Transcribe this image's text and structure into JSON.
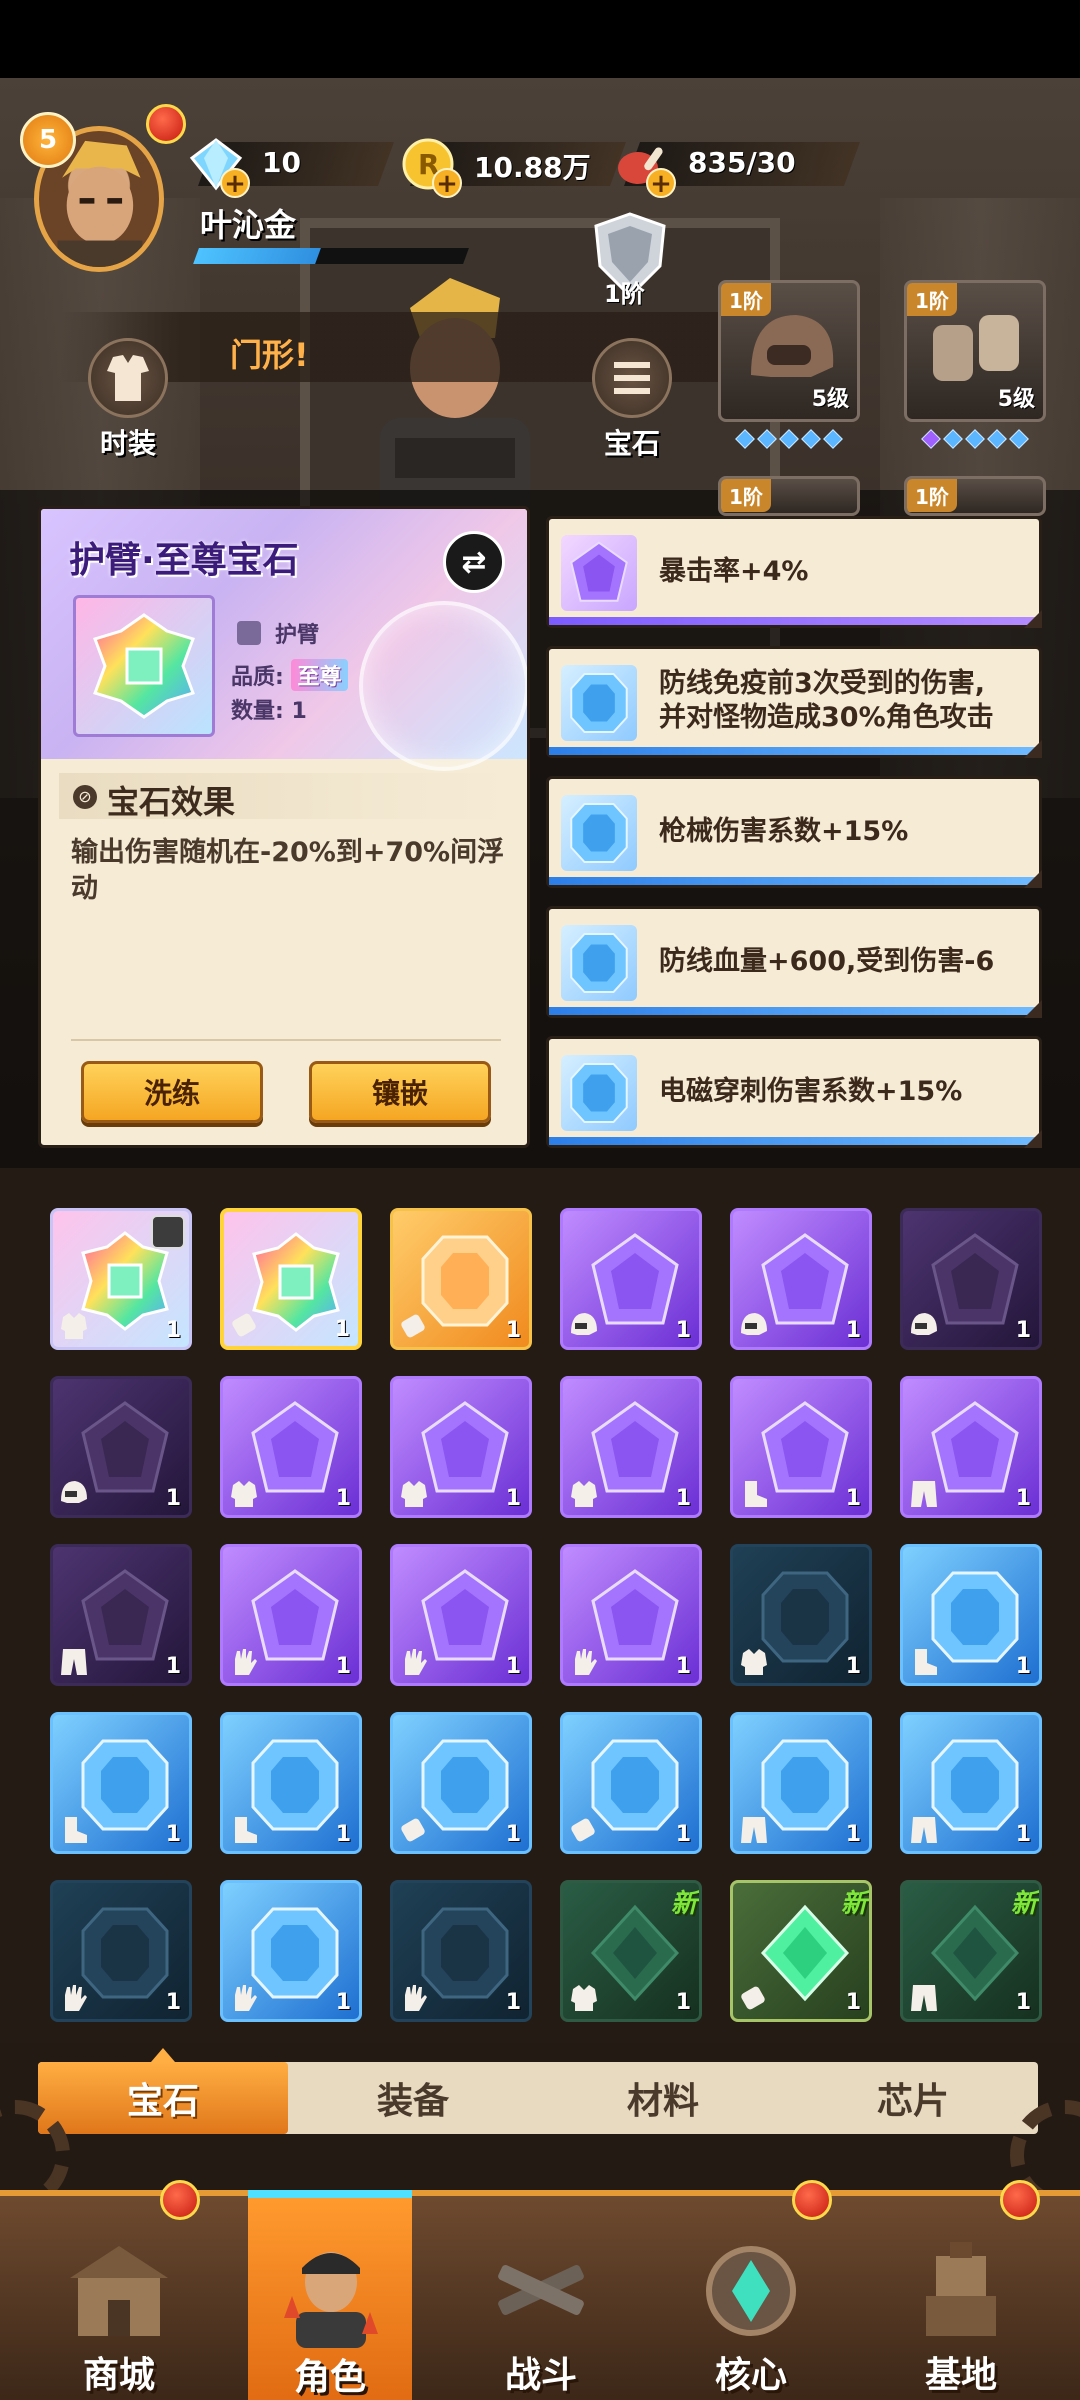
{
  "player": {
    "level": "5",
    "name": "叶沁金",
    "xp_fraction": 0.45
  },
  "resources": {
    "gems": "10",
    "coins": "10.88万",
    "stamina": "835/30"
  },
  "tier_label": "1阶",
  "marquee_text": "门形!",
  "side_buttons": {
    "fashion": "时装",
    "gem": "宝石"
  },
  "equipment": [
    {
      "tier": "1阶",
      "level": "5级",
      "icon": "helmet-icon"
    },
    {
      "tier": "1阶",
      "level": "5级",
      "icon": "gauntlet-icon"
    },
    {
      "tier": "1阶",
      "level": "",
      "icon": "slot-icon"
    },
    {
      "tier": "1阶",
      "level": "",
      "icon": "slot-icon"
    }
  ],
  "detail": {
    "title": "护臂·至尊宝石",
    "swap_glyph": "⇄",
    "slot": "护臂",
    "quality_label": "品质:",
    "quality_value": "至尊",
    "quantity_label": "数量:",
    "quantity_value": "1",
    "effect_title": "宝石效果",
    "effect_text": "输出伤害随机在-20%到+70%间浮动",
    "reforge_button": "洗练",
    "inlay_button": "镶嵌"
  },
  "affixes": [
    {
      "color": "purple",
      "line1": "暴击率+4%",
      "line2": ""
    },
    {
      "color": "blue",
      "line1": "防线免疫前3次受到的伤害,",
      "line2": "并对怪物造成30%角色攻击"
    },
    {
      "color": "blue",
      "line1": "枪械伤害系数+15%",
      "line2": ""
    },
    {
      "color": "blue",
      "line1": "防线血量+600,受到伤害-6",
      "line2": ""
    },
    {
      "color": "blue",
      "line1": "电磁穿刺伤害系数+15%",
      "line2": ""
    }
  ],
  "grid": [
    {
      "style": "prism",
      "slot": "armor",
      "count": "1",
      "lock": true
    },
    {
      "style": "prism",
      "slot": "arm",
      "count": "1",
      "selected": true
    },
    {
      "style": "orange",
      "slot": "arm",
      "count": "1"
    },
    {
      "style": "purple",
      "slot": "helmet",
      "count": "1"
    },
    {
      "style": "purple",
      "slot": "helmet",
      "count": "1"
    },
    {
      "style": "purple-dim",
      "slot": "helmet",
      "count": "1"
    },
    {
      "style": "purple-dim",
      "slot": "helmet",
      "count": "1"
    },
    {
      "style": "purple",
      "slot": "armor",
      "count": "1"
    },
    {
      "style": "purple",
      "slot": "armor",
      "count": "1"
    },
    {
      "style": "purple",
      "slot": "armor",
      "count": "1"
    },
    {
      "style": "purple",
      "slot": "boot",
      "count": "1"
    },
    {
      "style": "purple",
      "slot": "pants",
      "count": "1"
    },
    {
      "style": "purple-dim",
      "slot": "pants",
      "count": "1"
    },
    {
      "style": "purple",
      "slot": "glove",
      "count": "1"
    },
    {
      "style": "purple",
      "slot": "glove",
      "count": "1"
    },
    {
      "style": "purple",
      "slot": "glove",
      "count": "1"
    },
    {
      "style": "blue-dim",
      "slot": "armor",
      "count": "1"
    },
    {
      "style": "blue",
      "slot": "boot",
      "count": "1"
    },
    {
      "style": "blue",
      "slot": "boot",
      "count": "1"
    },
    {
      "style": "blue",
      "slot": "boot",
      "count": "1"
    },
    {
      "style": "blue",
      "slot": "arm",
      "count": "1"
    },
    {
      "style": "blue",
      "slot": "arm",
      "count": "1"
    },
    {
      "style": "blue",
      "slot": "pants",
      "count": "1"
    },
    {
      "style": "blue",
      "slot": "pants",
      "count": "1"
    },
    {
      "style": "blue-dim",
      "slot": "glove",
      "count": "1"
    },
    {
      "style": "blue",
      "slot": "glove",
      "count": "1"
    },
    {
      "style": "blue-dim",
      "slot": "glove",
      "count": "1"
    },
    {
      "style": "green",
      "slot": "armor",
      "count": "1",
      "badge": "新"
    },
    {
      "style": "green-bright",
      "slot": "arm",
      "count": "1",
      "badge": "新"
    },
    {
      "style": "green",
      "slot": "pants",
      "count": "1",
      "badge": "新"
    }
  ],
  "tabs": [
    "宝石",
    "装备",
    "材料",
    "芯片"
  ],
  "nav": [
    "商城",
    "角色",
    "战斗",
    "核心",
    "基地"
  ],
  "colors": {
    "accent_orange": "#f5a623",
    "rare_purple": "#8b4cf0",
    "rare_blue": "#2f8fe0",
    "new_badge_green": "#7ee83a"
  }
}
